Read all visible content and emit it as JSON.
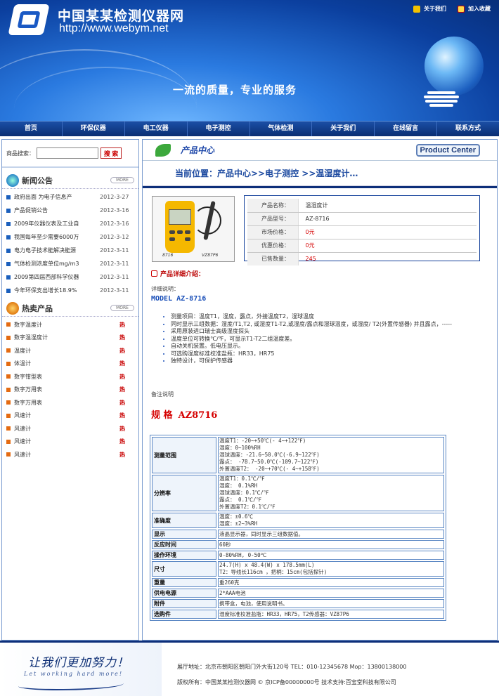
{
  "header": {
    "site_title": "中国某某检测仪器网",
    "site_url": "http://www.webym.net",
    "slogan": "一流的质量，专业的服务",
    "links": [
      "关于我们",
      "加入收藏"
    ]
  },
  "nav": [
    "首页",
    "环保仪器",
    "电工仪器",
    "电子测控",
    "气体检测",
    "关于我们",
    "在线留言",
    "联系方式"
  ],
  "search": {
    "label": "商品搜索：",
    "value": "",
    "button": "搜 索"
  },
  "news": {
    "title": "新闻公告",
    "more": "MORE",
    "items": [
      {
        "title": "政府出面 为电子信息产",
        "date": "2012-3-27"
      },
      {
        "title": "产品促销公告",
        "date": "2012-3-16"
      },
      {
        "title": "2009年仪器仪表及工业自",
        "date": "2012-3-16"
      },
      {
        "title": "我国每年至少需要6000万",
        "date": "2012-3-12"
      },
      {
        "title": "电力电子技术能解决能源",
        "date": "2012-3-11"
      },
      {
        "title": "气体检测浓度单位mg/m3",
        "date": "2012-3-11"
      },
      {
        "title": "2009第四届西部科学仪器",
        "date": "2012-3-11"
      },
      {
        "title": "今年环保支出增长18.9%",
        "date": "2012-3-11"
      }
    ]
  },
  "hot": {
    "title": "热卖产品",
    "more": "MORE",
    "tag": "热",
    "items": [
      "数字温度计",
      "数字温湿度计",
      "温度计",
      "体温计",
      "数字钳型表",
      "数字万用表",
      "数字万用表",
      "风速计",
      "风速计",
      "风速计",
      "风速计"
    ]
  },
  "main": {
    "title_cn": "产品中心",
    "title_en": "Product Center",
    "breadcrumb": "当前位置：产品中心>>电子测控 >>温湿度计…",
    "image_labels": [
      "8716",
      "VZ87P6"
    ],
    "specs": [
      {
        "k": "产品名称：",
        "v": "温湿度计"
      },
      {
        "k": "产品型号：",
        "v": "AZ-8716"
      },
      {
        "k": "市场价格：",
        "v": "0元"
      },
      {
        "k": "优惠价格：",
        "v": "0元"
      },
      {
        "k": "已售数量：",
        "v": "245"
      }
    ],
    "detail_head": "产品详细介绍：",
    "detail_sub": "详细说明：",
    "model": "MODEL AZ-8716",
    "features": [
      "测量项目：温度T1，湿度，露点，外接温度T2，湿球温度",
      "同时显示三组数据：湿度/T1,T2, 或湿度T1-T2,或湿度/露点和湿球温度，或湿度/ T2(外置传感器) 并且露点，-----",
      "采用原装进口瑞士高级湿度探头",
      "温度单位可转换℃/℉，可显示T1-T2二组温度差。",
      "自动关机装置。低电压显示。",
      "可选购湿度标准校准盐瓶：HR33，HR75",
      "独特设计，可保护传感器"
    ],
    "note": "备注说明",
    "spec_title_a": "规 格",
    "spec_title_b": "AZ8716",
    "spec_table": [
      {
        "k": "测量范围",
        "v": [
          "温度T1：-20~+50℃(- 4~+122℉)",
          "湿度：0~100%RH",
          "湿球温度：-21.6~50.0℃(-6.9~122℉)",
          "露点：  -78.7~50.0℃(-109.7~122℉)",
          "外置温度T2：  -20~+70℃(- 4~+158℉)"
        ]
      },
      {
        "k": "分辨率",
        "v": [
          "温度T1：0.1℃/℉",
          "湿度：  0.1%RH",
          "湿球温度：0.1℃/℉",
          "露点：  0.1℃/℉",
          "外置温度T2：0.1℃/℉"
        ]
      },
      {
        "k": "准确度",
        "v": [
          "温度：±0.6℃",
          "湿度：±2~3%RH"
        ]
      },
      {
        "k": "显示",
        "v": [
          "液晶显示器，同时显示三组数据值。"
        ]
      },
      {
        "k": "反应时间",
        "v": [
          "60秒"
        ]
      },
      {
        "k": "操作环境",
        "v": [
          " 0-80%RH, 0-50℃"
        ]
      },
      {
        "k": "尺寸",
        "v": [
          "24.7(H) x 48.4(W) x 178.5mm(L)",
          "T2：导线长116cm ，把柄：15cm(包括探针)"
        ]
      },
      {
        "k": "重量",
        "v": [
          "重260克"
        ]
      },
      {
        "k": "供电电源",
        "v": [
          "2*AAA电池"
        ]
      },
      {
        "k": "附件",
        "v": [
          "携带盒，电池，使用说明书。"
        ]
      },
      {
        "k": "选购件",
        "v": [
          "湿度标准校准盐瓶：HR33，HR75，T2传感器：VZ87P6"
        ]
      }
    ]
  },
  "footer": {
    "slogan": "让我们更加努力！",
    "slogan_en": "Let working hard more!",
    "address": "展厅地址：北京市朝阳区朝阳门外大街120号 TEL：010-12345678 Mop：13800138000",
    "copyright": "版权所有：中国某某检测仪器网 © 京ICP备00000000号 技术支持:百宝堂科技有限公司"
  },
  "colors": {
    "brand_blue": "#0b3f9e",
    "accent_red": "#d50000",
    "nav_dark": "#0a2e72"
  }
}
